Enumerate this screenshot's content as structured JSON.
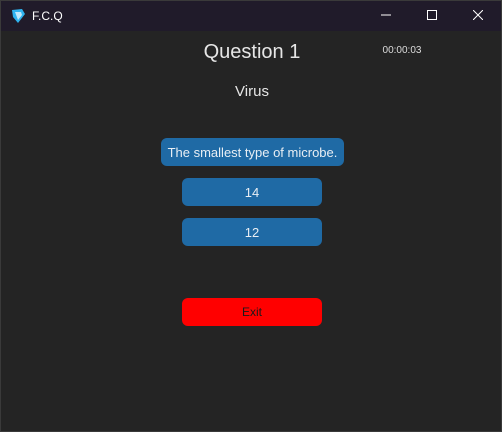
{
  "window": {
    "title": "F.C.Q"
  },
  "titlebar": {
    "icons": [
      "app-icon",
      "minimize-icon",
      "maximize-icon",
      "close-icon"
    ]
  },
  "quiz": {
    "question_title": "Question 1",
    "timer": "00:00:03",
    "word": "Virus",
    "answers": [
      "The smallest type of microbe.",
      "14",
      "12"
    ],
    "exit_label": "Exit"
  },
  "colors": {
    "background": "#242424",
    "titlebar": "#201b2a",
    "answer_button": "#1f6aa5",
    "exit_button": "#ff0000"
  }
}
